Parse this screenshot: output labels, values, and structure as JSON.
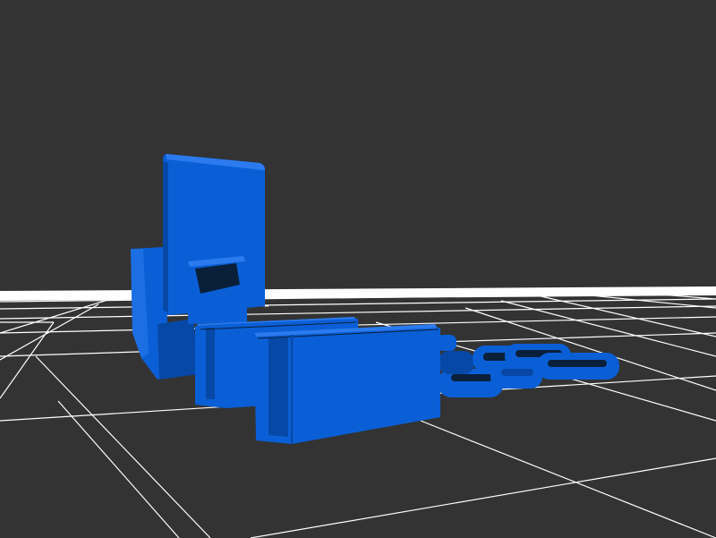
{
  "scene": {
    "background_color": "#333333",
    "grid_color": "#ffffff",
    "model_color": "#0a5fd6",
    "model_shadow_color": "#0748a6",
    "model_highlight_color": "#2b7bef",
    "parts": [
      "tall-plate",
      "angled-bracket",
      "slot-clip",
      "rear-block",
      "front-block",
      "chain-link-1",
      "chain-link-2",
      "chain-link-3"
    ]
  }
}
